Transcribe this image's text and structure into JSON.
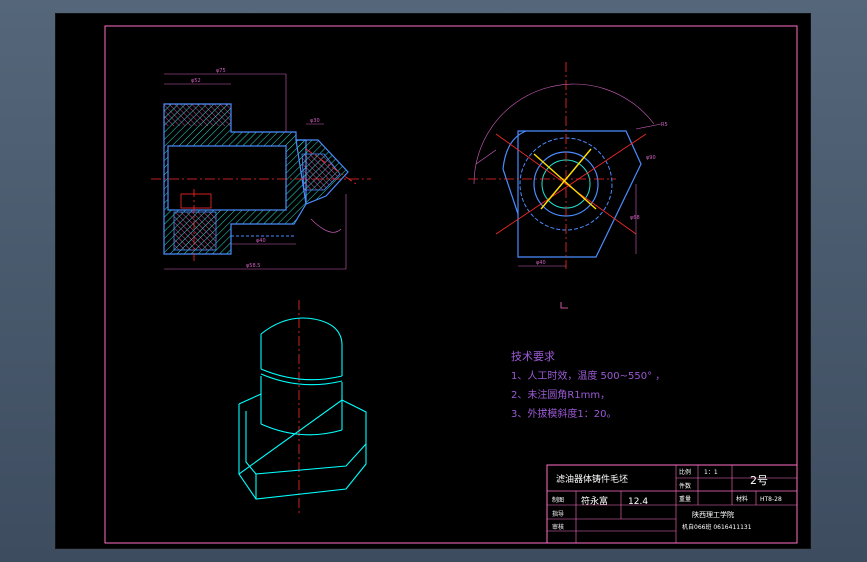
{
  "drawing": {
    "colors": {
      "background": "#000000",
      "frame": "#ff6ec7",
      "outline": "#4a8cff",
      "hatch": "#22e0d0",
      "centerline": "#ff2a2a",
      "dimension": "#d060c0",
      "iso_view": "#00ffff",
      "notes": "#9b59d6",
      "section_mark": "#ffe000"
    },
    "tech_requirements": {
      "title": "技术要求",
      "items": [
        "1、人工时效，温度 500~550° ，",
        "2、未注圆角R1mm，",
        "3、外拔模斜度1：20。"
      ]
    },
    "title_block": {
      "part_name": "滤油器体铸件毛坯",
      "scale_label": "比例",
      "scale_value": "1：1",
      "quantity_label": "件数",
      "sheet_no": "2号",
      "weight_label": "重量",
      "material_label": "材料",
      "material_value": "HT8-28",
      "drawn_label": "制图",
      "drawn_by": "符永富",
      "drawn_date": "12.4",
      "guide_label": "指导",
      "review_label": "审核",
      "school": "陕西理工学院",
      "class_info": "机自066班  0616411131"
    },
    "dimension_labels": {
      "left_view": [
        "φ75",
        "φ52",
        "φ30",
        "φ40",
        "φ58.5"
      ],
      "right_view": [
        "φ90",
        "R5",
        "φ40",
        "φ68"
      ]
    }
  }
}
